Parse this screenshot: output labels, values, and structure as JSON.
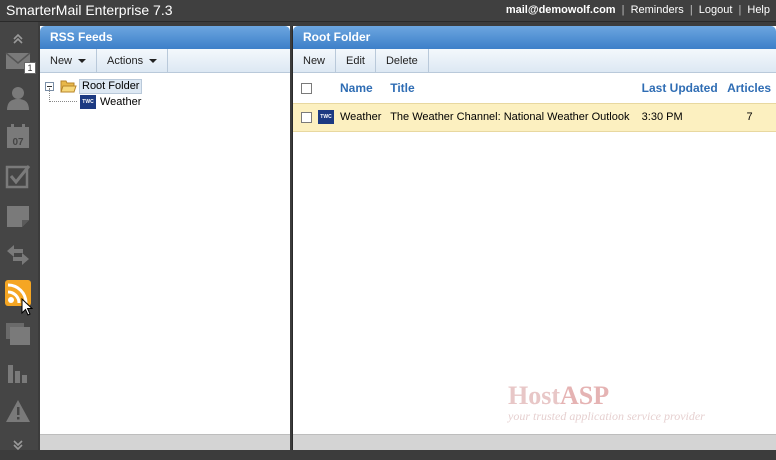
{
  "app": {
    "title": "SmarterMail Enterprise 7.3",
    "user_email": "mail@demowolf.com",
    "links": [
      "Reminders",
      "Logout",
      "Help"
    ],
    "separator": "|"
  },
  "sidebar": {
    "mail_badge": "1",
    "icons": [
      "collapse-up-icon",
      "mail-icon",
      "contacts-icon",
      "calendar-icon",
      "tasks-icon",
      "notes-icon",
      "sync-icon",
      "rss-icon",
      "files-icon",
      "reports-icon",
      "alerts-icon",
      "collapse-down-icon"
    ],
    "calendar_day": "07",
    "active": "rss-icon"
  },
  "left_pane": {
    "title": "RSS Feeds",
    "toolbar": {
      "new_label": "New",
      "actions_label": "Actions"
    },
    "tree": {
      "root_label": "Root Folder",
      "children": [
        {
          "label": "Weather",
          "icon_text": "TWC"
        }
      ]
    }
  },
  "right_pane": {
    "title": "Root Folder",
    "toolbar": {
      "new_label": "New",
      "edit_label": "Edit",
      "delete_label": "Delete"
    },
    "columns": {
      "name": "Name",
      "title": "Title",
      "last_updated": "Last Updated",
      "articles": "Articles"
    },
    "rows": [
      {
        "icon_text": "TWC",
        "name": "Weather",
        "title": "The Weather Channel: National Weather Outlook",
        "last_updated": "3:30 PM",
        "articles": "7"
      }
    ]
  },
  "watermark": {
    "brand_host": "Host",
    "brand_asp": "ASP",
    "tagline": "your trusted application service provider"
  },
  "colors": {
    "header_blue": "#3d7fc9",
    "column_blue": "#2f6db4",
    "selected_row": "#fcf0c0",
    "rss_orange": "#f5a623"
  }
}
